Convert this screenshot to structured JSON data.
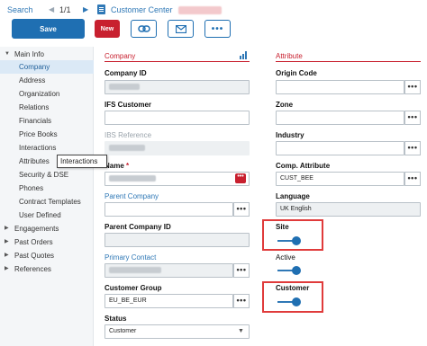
{
  "nav": {
    "search": "Search",
    "prev": "◀",
    "count": "1/1",
    "next": "▶",
    "title": "Customer Center"
  },
  "toolbar": {
    "save_label": "Save",
    "new_label": "New",
    "link_icon": "link-icon",
    "mail_icon": "mail-icon",
    "more_label": "•••"
  },
  "sidebar": {
    "items": [
      {
        "label": "Main Info",
        "expanded": true
      },
      {
        "label": "Company",
        "active": true
      },
      {
        "label": "Address"
      },
      {
        "label": "Organization"
      },
      {
        "label": "Relations"
      },
      {
        "label": "Financials"
      },
      {
        "label": "Price Books"
      },
      {
        "label": "Interactions"
      },
      {
        "label": "Attributes"
      },
      {
        "label": "Security & DSE"
      },
      {
        "label": "Phones"
      },
      {
        "label": "Contract Templates"
      },
      {
        "label": "User Defined"
      },
      {
        "label": "Engagements",
        "expanded": false
      },
      {
        "label": "Past Orders",
        "expanded": false
      },
      {
        "label": "Past Quotes",
        "expanded": false
      },
      {
        "label": "References",
        "expanded": false
      }
    ],
    "tooltip": "Interactions"
  },
  "company": {
    "heading": "Company",
    "company_id_label": "Company ID",
    "ifs_customer_label": "IFS Customer",
    "ifs_reference_label": "IBS Reference",
    "name_label": "Name",
    "required_mark": "*",
    "parent_company_label": "Parent Company",
    "parent_company_id_label": "Parent Company ID",
    "primary_contact_label": "Primary Contact",
    "customer_group_label": "Customer Group",
    "customer_group_value": "EU_BE_EUR",
    "status_label": "Status",
    "status_value": "Customer",
    "dots": "•••"
  },
  "attribute": {
    "heading": "Attribute",
    "origin_code_label": "Origin Code",
    "zone_label": "Zone",
    "industry_label": "Industry",
    "comp_attribute_label": "Comp. Attribute",
    "comp_attribute_value": "CUST_BEE",
    "language_label": "Language",
    "language_value": "UK English",
    "site_label": "Site",
    "active_label": "Active",
    "customer_label": "Customer",
    "site_on": true,
    "active_on": true,
    "customer_on": true,
    "dots": "•••"
  },
  "colors": {
    "primary": "#1f6fb2",
    "danger": "#c8202f",
    "highlight": "#e03b3b",
    "link": "#2f78b6"
  }
}
